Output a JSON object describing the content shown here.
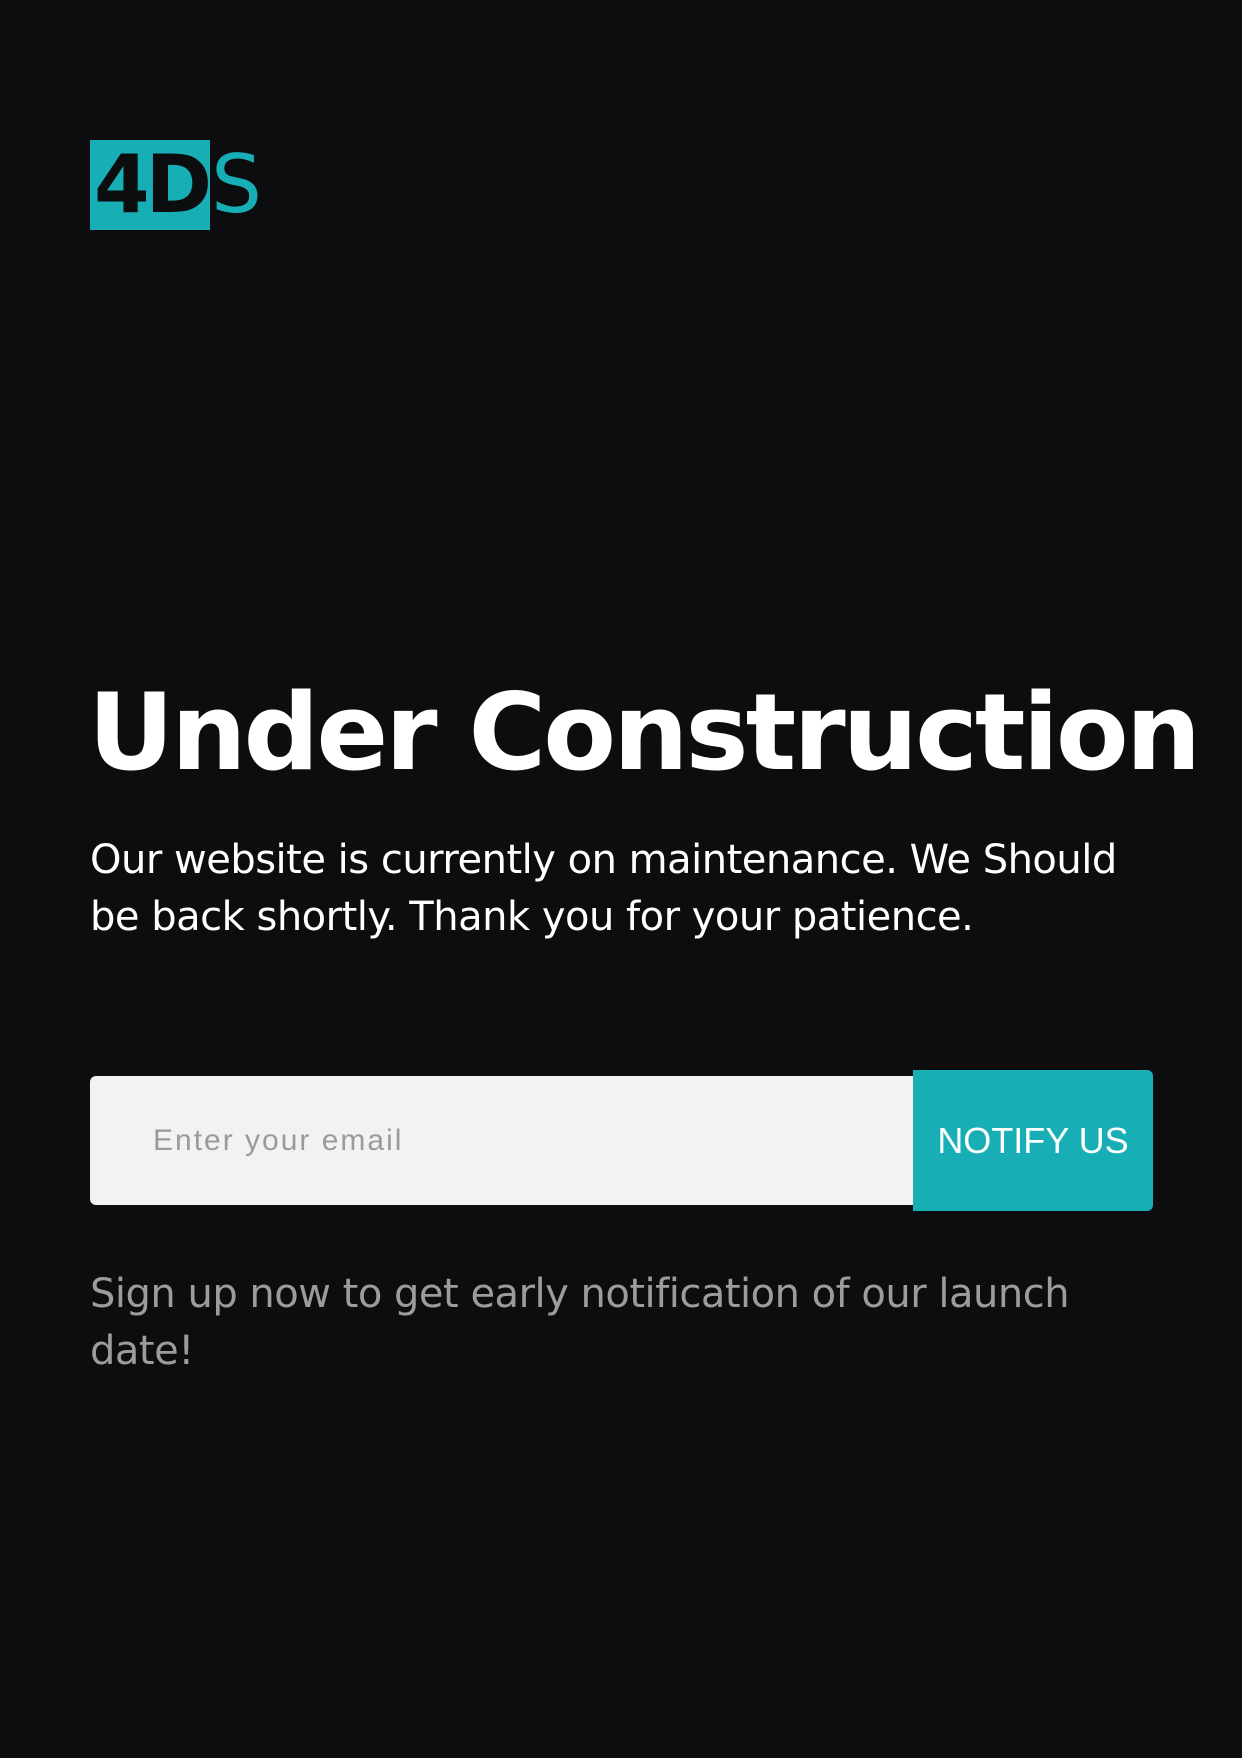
{
  "brand": {
    "logo_box_text": "4D",
    "logo_tail_text": "S"
  },
  "main": {
    "title": "Under Construction",
    "description": "Our website is currently on maintenance. We Should be back shortly. Thank you for your patience."
  },
  "form": {
    "email_placeholder": "Enter your email",
    "email_value": "",
    "notify_label": "NOTIFY US"
  },
  "signup_note": "Sign up now to get early notification of our launch date!",
  "colors": {
    "background": "#0c0d0f",
    "accent": "#17aeb6",
    "input_background": "#f2f2f2",
    "title_text": "#ffffff",
    "muted_text": "#9c9c9c"
  }
}
